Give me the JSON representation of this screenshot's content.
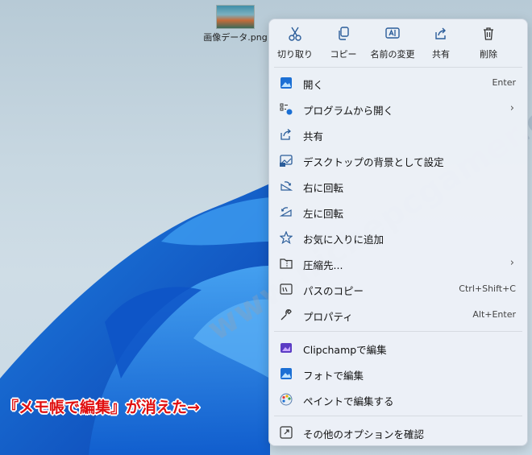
{
  "desktop": {
    "file_label": "画像データ.png"
  },
  "toolbar": {
    "cut": "切り取り",
    "copy": "コピー",
    "rename": "名前の変更",
    "share": "共有",
    "delete": "削除"
  },
  "menu": {
    "open": {
      "label": "開く",
      "shortcut": "Enter"
    },
    "open_with": {
      "label": "プログラムから開く"
    },
    "share": {
      "label": "共有"
    },
    "set_wallpaper": {
      "label": "デスクトップの背景として設定"
    },
    "rotate_right": {
      "label": "右に回転"
    },
    "rotate_left": {
      "label": "左に回転"
    },
    "add_favorites": {
      "label": "お気に入りに追加"
    },
    "compress": {
      "label": "圧縮先..."
    },
    "copy_path": {
      "label": "パスのコピー",
      "shortcut": "Ctrl+Shift+C"
    },
    "properties": {
      "label": "プロパティ",
      "shortcut": "Alt+Enter"
    },
    "clipchamp": {
      "label": "Clipchampで編集"
    },
    "photos": {
      "label": "フォトで編集"
    },
    "paint": {
      "label": "ペイントで編集する"
    },
    "more_options": {
      "label": "その他のオプションを確認"
    }
  },
  "annotation": "『メモ帳で編集』が消えた→",
  "watermark": "www.nichepcgamer.com",
  "colors": {
    "accent": "#2b5d9a",
    "annotation": "#e01010"
  }
}
